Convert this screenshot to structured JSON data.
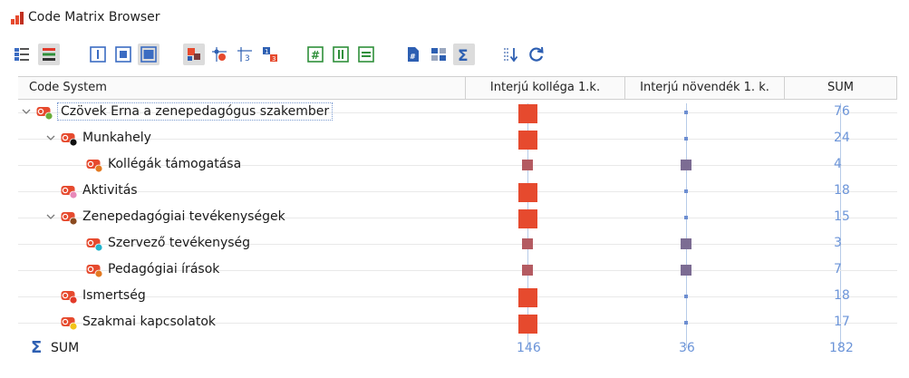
{
  "window": {
    "title": "Code Matrix Browser"
  },
  "toolbar": {
    "buttons": [
      {
        "icon": "matrix-icon"
      },
      {
        "icon": "color-bars-icon",
        "active": true
      },
      {
        "icon": "layout-top-icon"
      },
      {
        "icon": "layout-center-icon"
      },
      {
        "icon": "layout-full-icon",
        "active": true
      },
      {
        "icon": "symbol-square-icon",
        "active": true
      },
      {
        "icon": "symbol-circle-icon"
      },
      {
        "icon": "symbol-number-icon"
      },
      {
        "icon": "symbol-heatmap-icon"
      },
      {
        "icon": "sum-rows-icon"
      },
      {
        "icon": "sum-columns-icon"
      },
      {
        "icon": "sum-lines-icon"
      },
      {
        "icon": "document-icon"
      },
      {
        "icon": "group-icon"
      },
      {
        "icon": "sigma-icon",
        "active": true
      },
      {
        "icon": "sort-icon"
      },
      {
        "icon": "refresh-icon"
      }
    ]
  },
  "columns": {
    "code_system": "Code System",
    "col1": "Interjú kolléga 1.k.",
    "col2": "Interjú növendék 1. k.",
    "sum": "SUM"
  },
  "rows": [
    {
      "label": "Czövek Erna a zenepedagógus szakember",
      "level": 0,
      "expanded": true,
      "dot": "#6aad3a",
      "col1": "large",
      "col2": "small",
      "sum": "76"
    },
    {
      "label": "Munkahely",
      "level": 1,
      "expanded": true,
      "dot": "#111111",
      "col1": "large",
      "col2": "small",
      "sum": "24"
    },
    {
      "label": "Kollégák támogatása",
      "level": 2,
      "expanded": false,
      "dot": "#e37a22",
      "col1": "medium",
      "col2": "medium",
      "sum": "4"
    },
    {
      "label": "Aktivitás",
      "level": 1,
      "expanded": false,
      "dot": "#e889b9",
      "col1": "large",
      "col2": "small",
      "sum": "18"
    },
    {
      "label": "Zenepedagógiai tevékenységek",
      "level": 1,
      "expanded": true,
      "dot": "#8b4a1f",
      "col1": "large",
      "col2": "small",
      "sum": "15"
    },
    {
      "label": "Szervező tevékenység",
      "level": 2,
      "expanded": false,
      "dot": "#23b4cc",
      "col1": "medium",
      "col2": "medium",
      "sum": "3"
    },
    {
      "label": "Pedagógiai írások",
      "level": 2,
      "expanded": false,
      "dot": "#e37a22",
      "col1": "medium",
      "col2": "medium",
      "sum": "7"
    },
    {
      "label": "Ismertség",
      "level": 1,
      "expanded": false,
      "dot": "#e23a2a",
      "col1": "large",
      "col2": "small",
      "sum": "18"
    },
    {
      "label": "Szakmai kapcsolatok",
      "level": 1,
      "expanded": false,
      "dot": "#f2c318",
      "col1": "large",
      "col2": "small",
      "sum": "17"
    }
  ],
  "sum_row": {
    "label": "SUM",
    "col1": "146",
    "col2": "36",
    "sum": "182"
  },
  "colors": {
    "large": "#e64a2e",
    "medium": "#b45b62",
    "small_col1": "#e64a2e",
    "small_col2": "#6d8ed1",
    "medium_col2": "#7c6c93",
    "number": "#6b94d8"
  }
}
